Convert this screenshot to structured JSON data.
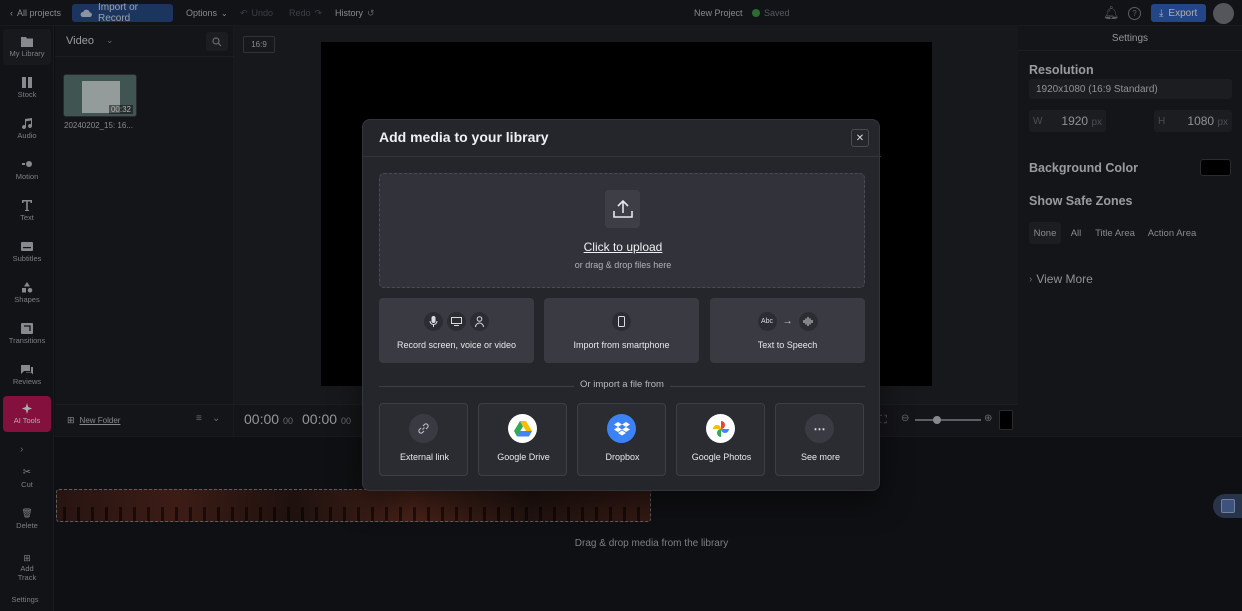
{
  "topbar": {
    "all_projects": "All projects",
    "import_record": "Import or Record",
    "options": "Options",
    "undo": "Undo",
    "redo": "Redo",
    "history": "History",
    "project_name": "New Project",
    "saved": "Saved",
    "export": "Export"
  },
  "sidebar": {
    "items": [
      {
        "label": "My Library",
        "icon": "folder-icon"
      },
      {
        "label": "Stock",
        "icon": "stock-icon"
      },
      {
        "label": "Audio",
        "icon": "music-icon"
      },
      {
        "label": "Motion",
        "icon": "motion-icon"
      },
      {
        "label": "Text",
        "icon": "text-icon"
      },
      {
        "label": "Subtitles",
        "icon": "subtitles-icon"
      },
      {
        "label": "Shapes",
        "icon": "shapes-icon"
      },
      {
        "label": "Transitions",
        "icon": "transitions-icon"
      },
      {
        "label": "Reviews",
        "icon": "reviews-icon"
      },
      {
        "label": "AI Tools",
        "icon": "ai-sparkle-icon"
      }
    ],
    "tools": {
      "cut": "Cut",
      "delete": "Delete",
      "add_track_1": "Add",
      "add_track_2": "Track",
      "settings": "Settings"
    }
  },
  "library": {
    "filter": "Video",
    "item": {
      "name": "20240202_15: 16...",
      "duration": "00:32"
    },
    "new_folder": "New Folder"
  },
  "canvas": {
    "aspect_ratio": "16:9"
  },
  "timeline": {
    "current_time": "00:00",
    "current_frames": "00",
    "total_time": "00:00",
    "total_frames": "00",
    "drop_hint": "Drag & drop media from the library"
  },
  "settings": {
    "title": "Settings",
    "resolution_heading": "Resolution",
    "resolution_value": "1920x1080 (16:9 Standard)",
    "width_label": "W",
    "width_value": "1920",
    "height_label": "H",
    "height_value": "1080",
    "unit": "px",
    "bg_heading": "Background Color",
    "bg_color": "#000000",
    "safe_heading": "Show Safe Zones",
    "safe_options": [
      "None",
      "All",
      "Title Area",
      "Action Area"
    ],
    "view_more": "View More"
  },
  "modal": {
    "title": "Add media to your library",
    "upload_title": "Click to upload",
    "upload_sub": "or drag & drop files here",
    "options": [
      "Record screen, voice or video",
      "Import from smartphone",
      "Text to Speech"
    ],
    "tts_abc": "Abc",
    "or_import": "Or import a file from",
    "sources": [
      "External link",
      "Google Drive",
      "Dropbox",
      "Google Photos",
      "See more"
    ]
  },
  "colors": {
    "accent": "#3568c9",
    "ai_tools": "#c2185b",
    "saved": "#43a047",
    "dropbox": "#3b82f6"
  }
}
